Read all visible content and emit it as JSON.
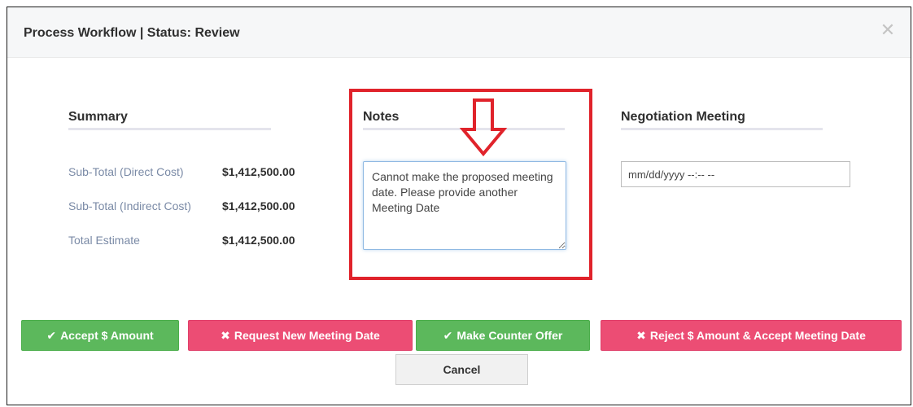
{
  "modal": {
    "title": "Process Workflow | Status: Review",
    "close_icon": "close-icon"
  },
  "summary": {
    "heading": "Summary",
    "rows": [
      {
        "label": "Sub-Total (Direct Cost)",
        "value": "$1,412,500.00"
      },
      {
        "label": "Sub-Total (Indirect Cost)",
        "value": "$1,412,500.00"
      },
      {
        "label": "Total Estimate",
        "value": "$1,412,500.00"
      }
    ]
  },
  "notes": {
    "heading": "Notes",
    "value": "Cannot make the proposed meeting date. Please provide another Meeting Date",
    "annotation_color": "#e0232b"
  },
  "meeting": {
    "heading": "Negotiation Meeting",
    "placeholder": "mm/dd/yyyy --:-- --"
  },
  "actions": {
    "accept": {
      "icon": "✔",
      "label": "Accept $ Amount"
    },
    "request_new_date": {
      "icon": "✖",
      "label": "Request New Meeting Date"
    },
    "counter_offer": {
      "icon": "✔",
      "label": "Make Counter Offer"
    },
    "reject_accept_date": {
      "icon": "✖",
      "label": "Reject $ Amount & Accept Meeting Date"
    },
    "cancel": {
      "label": "Cancel"
    }
  },
  "colors": {
    "success": "#5cb85c",
    "danger": "#ec4d74",
    "label_muted": "#7a8aa6"
  }
}
